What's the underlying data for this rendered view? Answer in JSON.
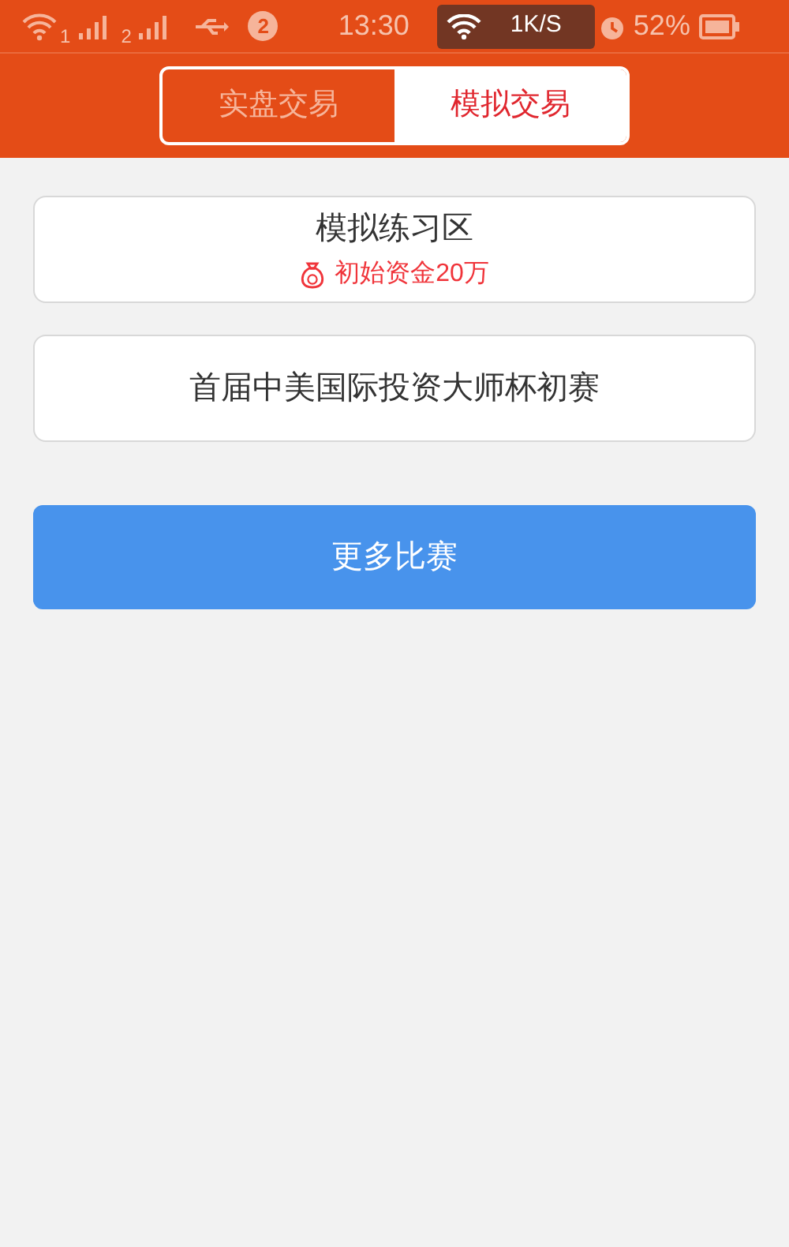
{
  "status_bar": {
    "sim_1": "1",
    "sim_2": "2",
    "notification_count": "2",
    "time": "13:30",
    "network_speed": "1K/S",
    "battery": "52%"
  },
  "tabs": [
    {
      "label": "实盘交易",
      "selected": false
    },
    {
      "label": "模拟交易",
      "selected": true
    }
  ],
  "cards": [
    {
      "title": "模拟练习区",
      "subtitle": "初始资金20万"
    },
    {
      "title": "首届中美国际投资大师杯初赛"
    }
  ],
  "more_button": "更多比赛"
}
